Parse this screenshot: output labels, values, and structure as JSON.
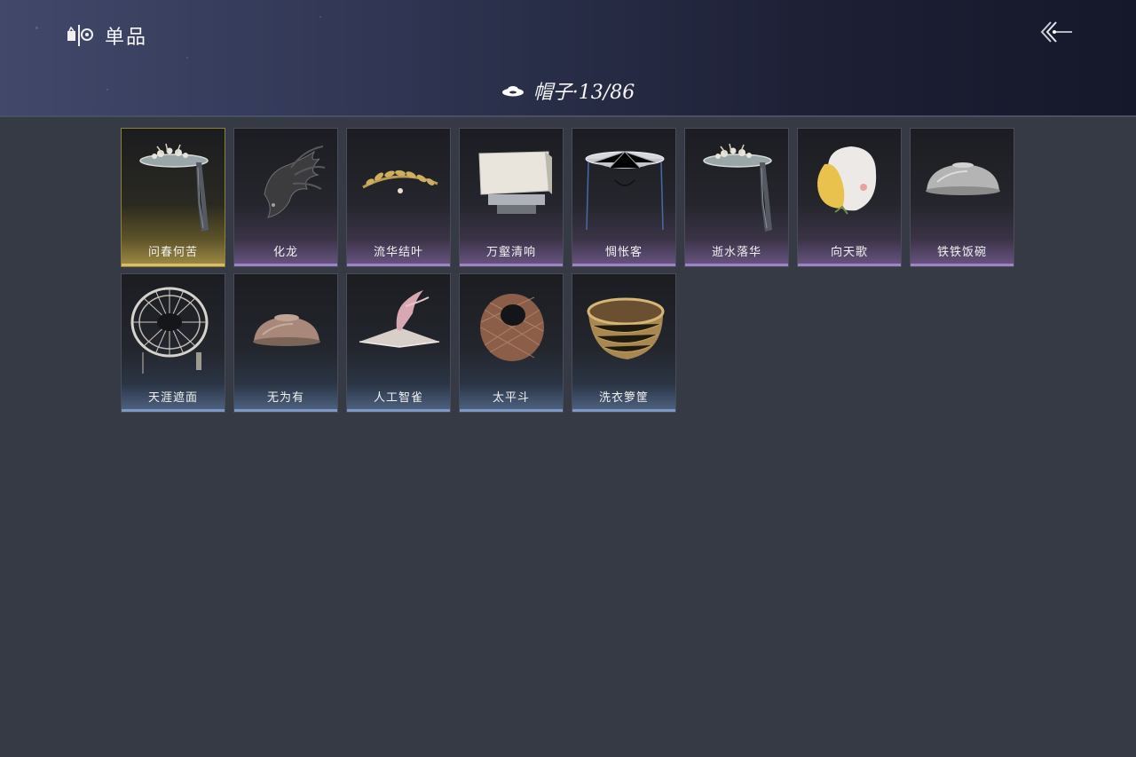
{
  "header": {
    "title": "单品",
    "title_icon": "wardrobe-icon",
    "back_icon": "back-arrow-icon"
  },
  "category": {
    "icon": "hat-icon",
    "label": "帽子·13/86"
  },
  "colors": {
    "background": "#363a44",
    "header_dark": "#15172a",
    "header_light": "#41486a",
    "rarity_gold": "#d8bf62",
    "rarity_purple": "#9c84c6",
    "rarity_blue": "#7d98c2"
  },
  "items": [
    {
      "name": "问春何苦",
      "rarity": "gold",
      "icon": "veiled-hat-icon"
    },
    {
      "name": "化龙",
      "rarity": "purple",
      "icon": "dragon-crown-icon"
    },
    {
      "name": "流华结叶",
      "rarity": "purple",
      "icon": "leaf-circlet-icon"
    },
    {
      "name": "万壑清响",
      "rarity": "purple",
      "icon": "scholar-cap-icon"
    },
    {
      "name": "惆怅客",
      "rarity": "purple",
      "icon": "conical-veil-hat-icon"
    },
    {
      "name": "逝水落华",
      "rarity": "purple",
      "icon": "veiled-hat-icon"
    },
    {
      "name": "向天歌",
      "rarity": "purple",
      "icon": "goose-hood-icon"
    },
    {
      "name": "铁铁饭碗",
      "rarity": "purple",
      "icon": "metal-bowl-hat-icon"
    },
    {
      "name": "天涯遮面",
      "rarity": "blue",
      "icon": "bamboo-frame-hat-icon"
    },
    {
      "name": "无为有",
      "rarity": "blue",
      "icon": "bowl-hat-icon"
    },
    {
      "name": "人工智雀",
      "rarity": "blue",
      "icon": "bird-hat-icon"
    },
    {
      "name": "太平斗",
      "rarity": "blue",
      "icon": "woven-conical-hat-icon"
    },
    {
      "name": "洗衣箩筐",
      "rarity": "blue",
      "icon": "basket-hat-icon"
    }
  ]
}
